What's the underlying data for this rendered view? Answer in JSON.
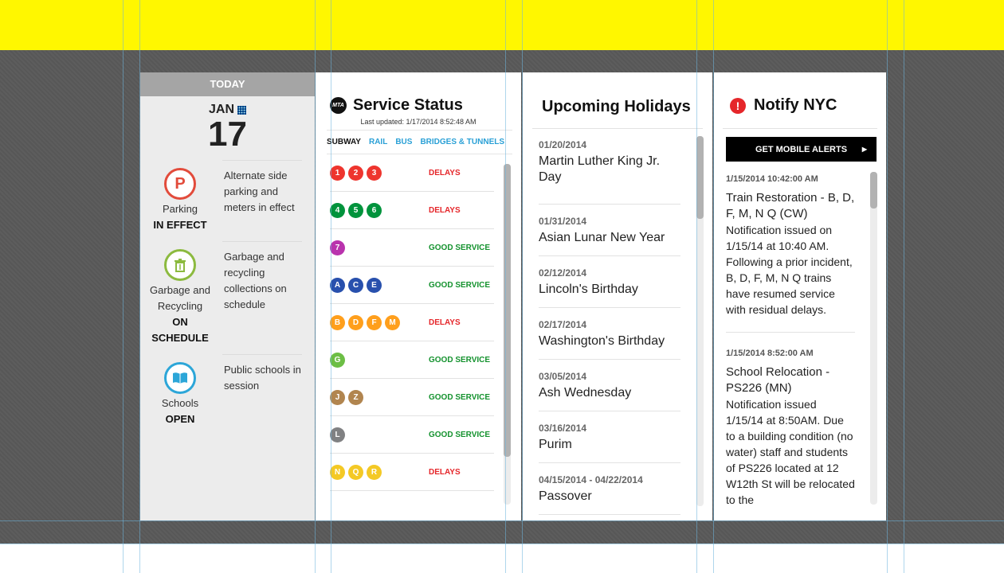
{
  "today": {
    "header": "TODAY",
    "month": "JAN",
    "day": "17",
    "items": [
      {
        "icon": "parking-icon",
        "name": "Parking",
        "state": "IN EFFECT",
        "description": "Alternate side parking and meters in effect",
        "color": "#e24b3b"
      },
      {
        "icon": "trash-can-icon",
        "name": "Garbage and Recycling",
        "state_line1": "ON",
        "state_line2": "SCHEDULE",
        "description": "Garbage and recycling collections on schedule",
        "color": "#8cba3f"
      },
      {
        "icon": "book-icon",
        "name": "Schools",
        "state": "OPEN",
        "description": "Public schools in session",
        "color": "#2ca6d8"
      }
    ]
  },
  "service": {
    "logo": "MTA",
    "title": "Service Status",
    "updated": "Last updated: 1/17/2014 8:52:48 AM",
    "tabs": [
      "SUBWAY",
      "RAIL",
      "BUS",
      "BRIDGES & TUNNELS"
    ],
    "lines": [
      {
        "routes": [
          "1",
          "2",
          "3"
        ],
        "color": "#ee352e",
        "status": "DELAYS"
      },
      {
        "routes": [
          "4",
          "5",
          "6"
        ],
        "color": "#00933c",
        "status": "DELAYS"
      },
      {
        "routes": [
          "7"
        ],
        "color": "#b933ad",
        "status": "GOOD SERVICE"
      },
      {
        "routes": [
          "A",
          "C",
          "E"
        ],
        "color": "#2850ad",
        "status": "GOOD SERVICE"
      },
      {
        "routes": [
          "B",
          "D",
          "F",
          "M"
        ],
        "color": "#ff9f1c",
        "status": "DELAYS"
      },
      {
        "routes": [
          "G"
        ],
        "color": "#6cbe45",
        "status": "GOOD SERVICE"
      },
      {
        "routes": [
          "J",
          "Z"
        ],
        "color": "#b1854f",
        "status": "GOOD SERVICE"
      },
      {
        "routes": [
          "L"
        ],
        "color": "#808183",
        "status": "GOOD SERVICE"
      },
      {
        "routes": [
          "N",
          "Q",
          "R"
        ],
        "color": "#f4c925",
        "status": "DELAYS"
      }
    ],
    "status_colors": {
      "DELAYS": "#e5262a",
      "GOOD SERVICE": "#14922e"
    }
  },
  "holidays": {
    "title": "Upcoming Holidays",
    "items": [
      {
        "date": "01/20/2014",
        "name": "Martin Luther King Jr. Day"
      },
      {
        "date": "01/31/2014",
        "name": "Asian Lunar New Year"
      },
      {
        "date": "02/12/2014",
        "name": "Lincoln's Birthday"
      },
      {
        "date": "02/17/2014",
        "name": "Washington's Birthday"
      },
      {
        "date": "03/05/2014",
        "name": "Ash Wednesday"
      },
      {
        "date": "03/16/2014",
        "name": "Purim"
      },
      {
        "date": "04/15/2014 - 04/22/2014",
        "name": "Passover"
      }
    ]
  },
  "notify": {
    "title": "Notify NYC",
    "button_label": "GET MOBILE ALERTS",
    "items": [
      {
        "time": "1/15/2014 10:42:00 AM",
        "title": "Train Restoration - B, D, F, M, N Q (CW)",
        "body": "Notification issued on 1/15/14 at 10:40 AM. Following a prior incident, B, D, F, M, N Q trains have resumed service with residual delays."
      },
      {
        "time": "1/15/2014 8:52:00 AM",
        "title": "School Relocation - PS226 (MN)",
        "body": "Notification issued 1/15/14 at 8:50AM. Due to a building condition (no water) staff and students of PS226 located at 12 W12th St will be relocated to the"
      }
    ]
  }
}
